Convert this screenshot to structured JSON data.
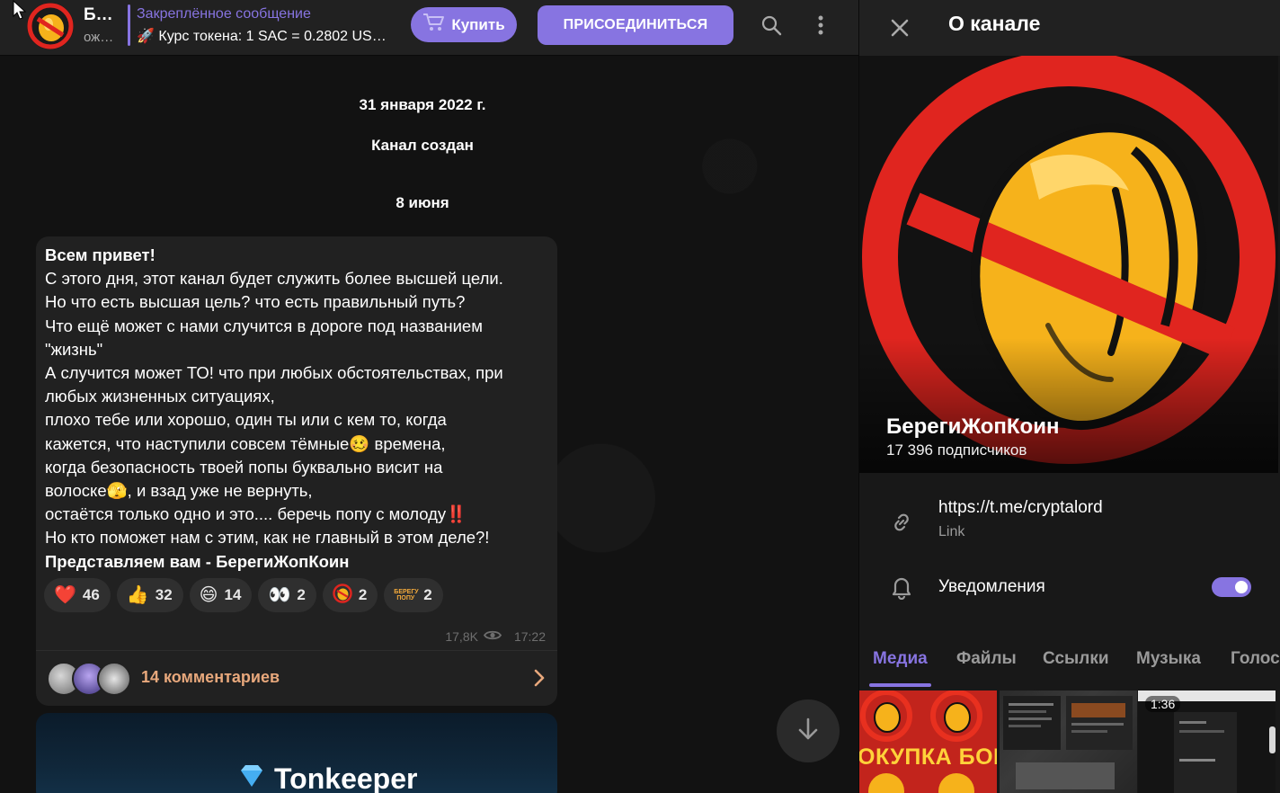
{
  "header": {
    "channel_title": "Б…",
    "channel_subtitle": "ож…",
    "pinned_label": "Закреплённое сообщение",
    "pinned_text": "🚀 Курс токена: 1 SAC = 0.2802 US…",
    "buy_label": "Купить",
    "join_label": "ПРИСОЕДИНИТЬСЯ",
    "icons": [
      "cart-icon",
      "search-icon",
      "more-vertical-icon"
    ]
  },
  "chat": {
    "date_1": "31 января 2022 г.",
    "service_1": "Канал создан",
    "date_2": "8 июня",
    "message": {
      "lines": [
        "Всем привет!",
        "С этого дня, этот канал будет служить более высшей цели.",
        "Но что есть высшая цель? что есть правильный путь?",
        "Что ещё может с нами случится в дороге под названием",
        "\"жизнь\"",
        "А случится может ТО! что при любых обстоятельствах, при",
        "любых жизненных ситуациях,",
        "плохо тебе или хорошо, один ты или с кем то, когда",
        "кажется, что наступили совсем тёмные🥴 времена,",
        "когда безопасность твоей попы буквально висит на",
        "волоске🫣, и взад уже не вернуть,",
        "остаётся только одно и это.... беречь попу с молоду‼️",
        "Но кто поможет нам с этим, как не главный в этом деле?!",
        "Представляем вам - БерегиЖопКоин"
      ],
      "reactions": [
        {
          "emoji": "❤️",
          "count": "46"
        },
        {
          "emoji": "👍",
          "count": "32"
        },
        {
          "emoji": "😄",
          "count": "14"
        },
        {
          "emoji": "👀",
          "count": "2"
        },
        {
          "emoji": "channel-logo",
          "count": "2"
        },
        {
          "emoji": "БЕРЕГУ ПОПУ",
          "count": "2"
        }
      ],
      "views": "17,8K",
      "time": "17:22",
      "comments_label": "14 комментариев"
    },
    "next_message_title": "Tonkeeper"
  },
  "panel": {
    "title": "О канале",
    "channel_name": "БерегиЖопКоин",
    "subscribers": "17 396 подписчиков",
    "link": "https://t.me/cryptalord",
    "link_caption": "Link",
    "notifications_label": "Уведомления",
    "notifications_on": true,
    "tabs": [
      "Медиа",
      "Файлы",
      "Ссылки",
      "Музыка",
      "Голос"
    ],
    "active_tab": "Медиа",
    "media": [
      {
        "kind": "image",
        "caption": "ОКУПКА БОНУСО"
      },
      {
        "kind": "image",
        "caption": ""
      },
      {
        "kind": "video",
        "duration": "1:36"
      }
    ]
  },
  "colors": {
    "accent": "#8774e1",
    "background": "#0f0f0f",
    "surface": "#212121",
    "comment_text": "#e8a87c"
  }
}
